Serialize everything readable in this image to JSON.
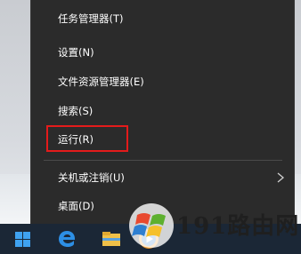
{
  "context_menu": {
    "items": [
      {
        "label": "任务管理器(T)"
      },
      {
        "label": "设置(N)"
      },
      {
        "label": "文件资源管理器(E)"
      },
      {
        "label": "搜索(S)"
      },
      {
        "label": "运行(R)"
      },
      {
        "label": "关机或注销(U)"
      },
      {
        "label": "桌面(D)"
      }
    ],
    "highlighted_item": "运行(R)",
    "highlight_color": "#e41b1b",
    "background_color": "#2b2b2b"
  },
  "taskbar": {
    "icons": [
      "windows-start-icon",
      "edge-browser-icon",
      "file-explorer-icon",
      "windows-media-player-icon"
    ],
    "background_color": "#1b2736"
  },
  "watermark": {
    "text": "191路由网"
  }
}
